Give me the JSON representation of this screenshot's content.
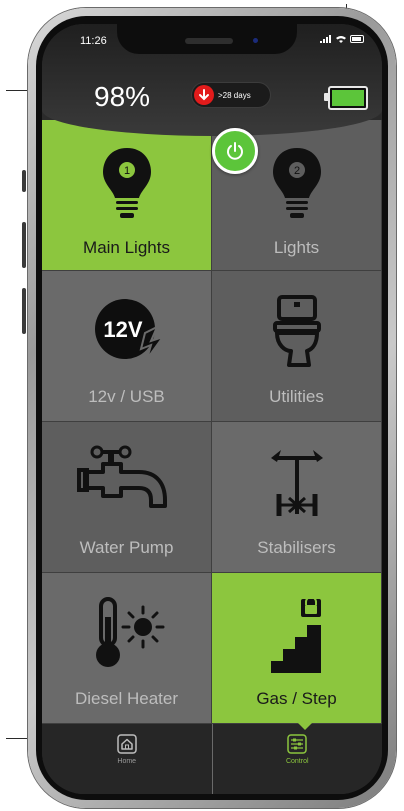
{
  "status_bar": {
    "time": "11:26",
    "signal_icon": "signal-icon",
    "wifi_icon": "wifi-icon",
    "battery_icon": "battery-icon"
  },
  "header": {
    "battery_percent": "98%",
    "days_remaining": ">28 days",
    "battery_level": 1.0,
    "power_button_icon": "power-icon"
  },
  "tiles": [
    {
      "id": "main-lights",
      "label": "Main Lights",
      "icon": "bulb-1-icon",
      "active": true
    },
    {
      "id": "lights",
      "label": "Lights",
      "icon": "bulb-2-icon",
      "active": false
    },
    {
      "id": "12v-usb",
      "label": "12v / USB",
      "icon": "12v-icon",
      "active": false
    },
    {
      "id": "utilities",
      "label": "Utilities",
      "icon": "toilet-icon",
      "active": false
    },
    {
      "id": "water-pump",
      "label": "Water Pump",
      "icon": "tap-icon",
      "active": false
    },
    {
      "id": "stabilisers",
      "label": "Stabilisers",
      "icon": "stabiliser-icon",
      "active": false
    },
    {
      "id": "diesel-heater",
      "label": "Diesel Heater",
      "icon": "thermometer-sun-icon",
      "active": false
    },
    {
      "id": "gas-step",
      "label": "Gas / Step",
      "icon": "step-lock-icon",
      "active": true
    }
  ],
  "tabbar": {
    "home_label": "Home",
    "control_label": "Control",
    "active": "Control"
  },
  "colors": {
    "accent_green": "#8cc63e",
    "alert_red": "#e21b1b",
    "tile_gray": "#6a6a6a"
  }
}
